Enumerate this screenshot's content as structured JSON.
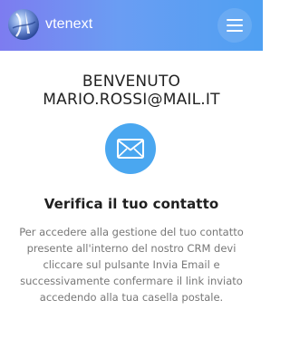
{
  "header": {
    "brand": "vtenext",
    "menu_icon": "hamburger-menu-icon",
    "logo_icon": "vtenext-globe-logo"
  },
  "welcome": {
    "line1": "BENVENUTO",
    "line2": "MARIO.ROSSI@MAIL.IT"
  },
  "mail_icon": "envelope-icon",
  "title": "Verifica il tuo contatto",
  "description": "Per accedere alla gestione del tuo contatto presente all'interno del nostro CRM devi cliccare sul pulsante Invia Email e successivamente confermare il link inviato accedendo alla tua casella postale.",
  "colors": {
    "header_gradient_start": "#7d7cf0",
    "header_gradient_end": "#4fa0f2",
    "accent": "#4aa7f0"
  }
}
